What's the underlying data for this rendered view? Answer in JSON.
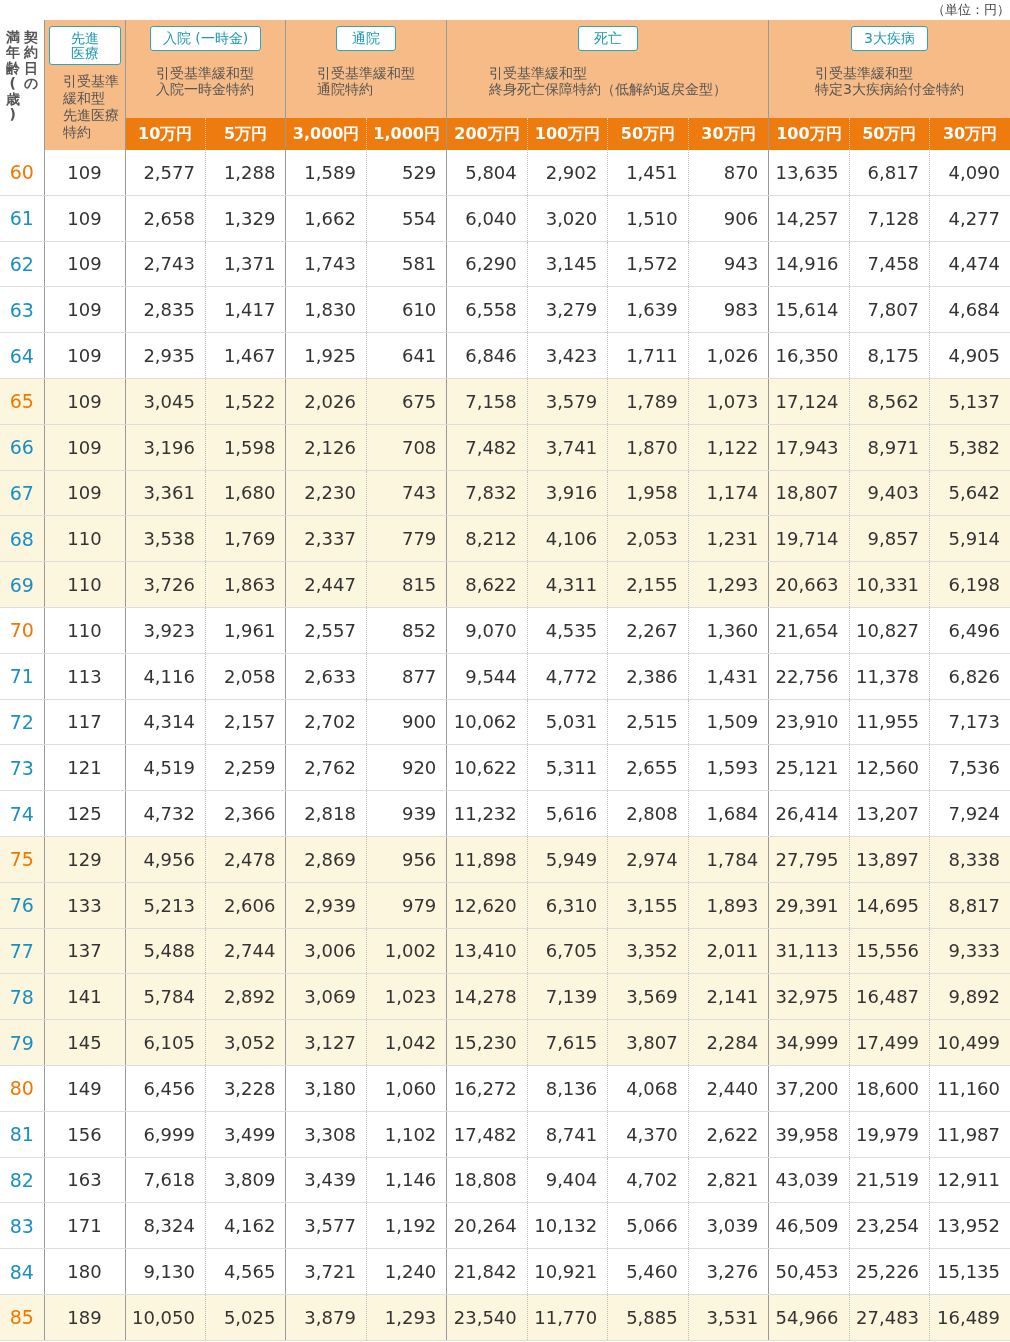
{
  "unit_note": "（単位：円）",
  "corner_header": [
    {
      "text": "満年齢(歳)"
    },
    {
      "text": "契約日の"
    }
  ],
  "column_groups": [
    {
      "badge": [
        "先進",
        "医療"
      ],
      "title": [
        "引受基準",
        "緩和型",
        "先進医療",
        "特約"
      ]
    },
    {
      "badge": [
        "入院",
        "(一時金)"
      ],
      "title": [
        "引受基準緩和型",
        "入院一時金特約"
      ],
      "columns": [
        "10万円",
        "5万円"
      ]
    },
    {
      "badge": [
        "通院"
      ],
      "title": [
        "引受基準緩和型",
        "通院特約"
      ],
      "columns": [
        "3,000円",
        "1,000円"
      ]
    },
    {
      "badge": [
        "死亡"
      ],
      "title": [
        "引受基準緩和型",
        "終身死亡保障特約（低解約返戻金型）"
      ],
      "columns": [
        "200万円",
        "100万円",
        "50万円",
        "30万円"
      ]
    },
    {
      "badge": [
        "3大疾病"
      ],
      "title": [
        "引受基準緩和型",
        "特定3大疾病給付金特約"
      ],
      "columns": [
        "100万円",
        "50万円",
        "30万円"
      ]
    }
  ],
  "rows": [
    {
      "age": "60",
      "color": "#f07800",
      "shaded": false,
      "values": [
        "109",
        "2,577",
        "1,288",
        "1,589",
        "529",
        "5,804",
        "2,902",
        "1,451",
        "870",
        "13,635",
        "6,817",
        "4,090"
      ]
    },
    {
      "age": "61",
      "color": "#1a8fc4",
      "shaded": false,
      "values": [
        "109",
        "2,658",
        "1,329",
        "1,662",
        "554",
        "6,040",
        "3,020",
        "1,510",
        "906",
        "14,257",
        "7,128",
        "4,277"
      ]
    },
    {
      "age": "62",
      "color": "#1a8fc4",
      "shaded": false,
      "values": [
        "109",
        "2,743",
        "1,371",
        "1,743",
        "581",
        "6,290",
        "3,145",
        "1,572",
        "943",
        "14,916",
        "7,458",
        "4,474"
      ]
    },
    {
      "age": "63",
      "color": "#1a8fc4",
      "shaded": false,
      "values": [
        "109",
        "2,835",
        "1,417",
        "1,830",
        "610",
        "6,558",
        "3,279",
        "1,639",
        "983",
        "15,614",
        "7,807",
        "4,684"
      ]
    },
    {
      "age": "64",
      "color": "#1a8fc4",
      "shaded": false,
      "values": [
        "109",
        "2,935",
        "1,467",
        "1,925",
        "641",
        "6,846",
        "3,423",
        "1,711",
        "1,026",
        "16,350",
        "8,175",
        "4,905"
      ]
    },
    {
      "age": "65",
      "color": "#f07800",
      "shaded": true,
      "values": [
        "109",
        "3,045",
        "1,522",
        "2,026",
        "675",
        "7,158",
        "3,579",
        "1,789",
        "1,073",
        "17,124",
        "8,562",
        "5,137"
      ]
    },
    {
      "age": "66",
      "color": "#1a8fc4",
      "shaded": true,
      "values": [
        "109",
        "3,196",
        "1,598",
        "2,126",
        "708",
        "7,482",
        "3,741",
        "1,870",
        "1,122",
        "17,943",
        "8,971",
        "5,382"
      ]
    },
    {
      "age": "67",
      "color": "#1a8fc4",
      "shaded": true,
      "values": [
        "109",
        "3,361",
        "1,680",
        "2,230",
        "743",
        "7,832",
        "3,916",
        "1,958",
        "1,174",
        "18,807",
        "9,403",
        "5,642"
      ]
    },
    {
      "age": "68",
      "color": "#1a8fc4",
      "shaded": true,
      "values": [
        "110",
        "3,538",
        "1,769",
        "2,337",
        "779",
        "8,212",
        "4,106",
        "2,053",
        "1,231",
        "19,714",
        "9,857",
        "5,914"
      ]
    },
    {
      "age": "69",
      "color": "#1a8fc4",
      "shaded": true,
      "values": [
        "110",
        "3,726",
        "1,863",
        "2,447",
        "815",
        "8,622",
        "4,311",
        "2,155",
        "1,293",
        "20,663",
        "10,331",
        "6,198"
      ]
    },
    {
      "age": "70",
      "color": "#f07800",
      "shaded": false,
      "values": [
        "110",
        "3,923",
        "1,961",
        "2,557",
        "852",
        "9,070",
        "4,535",
        "2,267",
        "1,360",
        "21,654",
        "10,827",
        "6,496"
      ]
    },
    {
      "age": "71",
      "color": "#1a8fc4",
      "shaded": false,
      "values": [
        "113",
        "4,116",
        "2,058",
        "2,633",
        "877",
        "9,544",
        "4,772",
        "2,386",
        "1,431",
        "22,756",
        "11,378",
        "6,826"
      ]
    },
    {
      "age": "72",
      "color": "#1a8fc4",
      "shaded": false,
      "values": [
        "117",
        "4,314",
        "2,157",
        "2,702",
        "900",
        "10,062",
        "5,031",
        "2,515",
        "1,509",
        "23,910",
        "11,955",
        "7,173"
      ]
    },
    {
      "age": "73",
      "color": "#1a8fc4",
      "shaded": false,
      "values": [
        "121",
        "4,519",
        "2,259",
        "2,762",
        "920",
        "10,622",
        "5,311",
        "2,655",
        "1,593",
        "25,121",
        "12,560",
        "7,536"
      ]
    },
    {
      "age": "74",
      "color": "#1a8fc4",
      "shaded": false,
      "values": [
        "125",
        "4,732",
        "2,366",
        "2,818",
        "939",
        "11,232",
        "5,616",
        "2,808",
        "1,684",
        "26,414",
        "13,207",
        "7,924"
      ]
    },
    {
      "age": "75",
      "color": "#f07800",
      "shaded": true,
      "values": [
        "129",
        "4,956",
        "2,478",
        "2,869",
        "956",
        "11,898",
        "5,949",
        "2,974",
        "1,784",
        "27,795",
        "13,897",
        "8,338"
      ]
    },
    {
      "age": "76",
      "color": "#1a8fc4",
      "shaded": true,
      "values": [
        "133",
        "5,213",
        "2,606",
        "2,939",
        "979",
        "12,620",
        "6,310",
        "3,155",
        "1,893",
        "29,391",
        "14,695",
        "8,817"
      ]
    },
    {
      "age": "77",
      "color": "#1a8fc4",
      "shaded": true,
      "values": [
        "137",
        "5,488",
        "2,744",
        "3,006",
        "1,002",
        "13,410",
        "6,705",
        "3,352",
        "2,011",
        "31,113",
        "15,556",
        "9,333"
      ]
    },
    {
      "age": "78",
      "color": "#1a8fc4",
      "shaded": true,
      "values": [
        "141",
        "5,784",
        "2,892",
        "3,069",
        "1,023",
        "14,278",
        "7,139",
        "3,569",
        "2,141",
        "32,975",
        "16,487",
        "9,892"
      ]
    },
    {
      "age": "79",
      "color": "#1a8fc4",
      "shaded": true,
      "values": [
        "145",
        "6,105",
        "3,052",
        "3,127",
        "1,042",
        "15,230",
        "7,615",
        "3,807",
        "2,284",
        "34,999",
        "17,499",
        "10,499"
      ]
    },
    {
      "age": "80",
      "color": "#f07800",
      "shaded": false,
      "values": [
        "149",
        "6,456",
        "3,228",
        "3,180",
        "1,060",
        "16,272",
        "8,136",
        "4,068",
        "2,440",
        "37,200",
        "18,600",
        "11,160"
      ]
    },
    {
      "age": "81",
      "color": "#1a8fc4",
      "shaded": false,
      "values": [
        "156",
        "6,999",
        "3,499",
        "3,308",
        "1,102",
        "17,482",
        "8,741",
        "4,370",
        "2,622",
        "39,958",
        "19,979",
        "11,987"
      ]
    },
    {
      "age": "82",
      "color": "#1a8fc4",
      "shaded": false,
      "values": [
        "163",
        "7,618",
        "3,809",
        "3,439",
        "1,146",
        "18,808",
        "9,404",
        "4,702",
        "2,821",
        "43,039",
        "21,519",
        "12,911"
      ]
    },
    {
      "age": "83",
      "color": "#1a8fc4",
      "shaded": false,
      "values": [
        "171",
        "8,324",
        "4,162",
        "3,577",
        "1,192",
        "20,264",
        "10,132",
        "5,066",
        "3,039",
        "46,509",
        "23,254",
        "13,952"
      ]
    },
    {
      "age": "84",
      "color": "#1a8fc4",
      "shaded": false,
      "values": [
        "180",
        "9,130",
        "4,565",
        "3,721",
        "1,240",
        "21,842",
        "10,921",
        "5,460",
        "3,276",
        "50,453",
        "25,226",
        "15,135"
      ]
    },
    {
      "age": "85",
      "color": "#f07800",
      "shaded": true,
      "values": [
        "189",
        "10,050",
        "5,025",
        "3,879",
        "1,293",
        "23,540",
        "11,770",
        "5,885",
        "3,531",
        "54,966",
        "27,483",
        "16,489"
      ]
    }
  ]
}
